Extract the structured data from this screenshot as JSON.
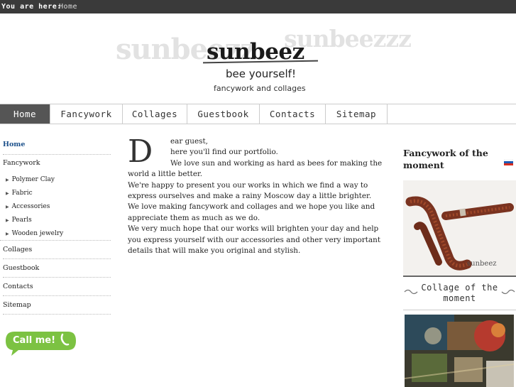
{
  "breadcrumb": {
    "label": "You are here:",
    "current": "Home"
  },
  "header": {
    "watermark_left": "sunbeezz",
    "watermark_right": "sunbeezzz",
    "logo": "sunbeez",
    "tagline": "bee yourself!",
    "subtagline": "fancywork and collages"
  },
  "nav": {
    "items": [
      {
        "label": "Home"
      },
      {
        "label": "Fancywork"
      },
      {
        "label": "Collages"
      },
      {
        "label": "Guestbook"
      },
      {
        "label": "Contacts"
      },
      {
        "label": "Sitemap"
      }
    ]
  },
  "sidebar": {
    "home": "Home",
    "fancywork": "Fancywork",
    "subitems": [
      "Polymer Clay",
      "Fabric",
      "Accessories",
      "Pearls",
      "Wooden jewelry"
    ],
    "collages": "Collages",
    "guestbook": "Guestbook",
    "contacts": "Contacts",
    "sitemap": "Sitemap",
    "call_button": "Call me!"
  },
  "content": {
    "dropcap": "D",
    "first_line": "ear guest,",
    "lines": [
      "here you'll find our portfolio.",
      "We love sun and working as hard as bees for making the world a little better.",
      "We're happy to present you our works in which we find a way to express ourselves and make a rainy Moscow day a little brighter.",
      "We love making fancywork and collages and we hope you like and appreciate them as much as we do.",
      "We very much hope that our works will brighten your day and help you express yourself with our accessories and other very important details that will make you original and stylish."
    ]
  },
  "right": {
    "fancywork_title": "Fancywork of the moment",
    "fancywork_caption": "sunbeez",
    "collage_title": "Collage of the moment"
  },
  "colors": {
    "topbar": "#3a3a3a",
    "nav_active": "#555555",
    "link": "#1a4f8a",
    "call_green": "#7cc242"
  },
  "icons": [
    "triangle-right-icon",
    "russian-flag-icon",
    "phone-icon",
    "swirl-ornament-icon"
  ]
}
